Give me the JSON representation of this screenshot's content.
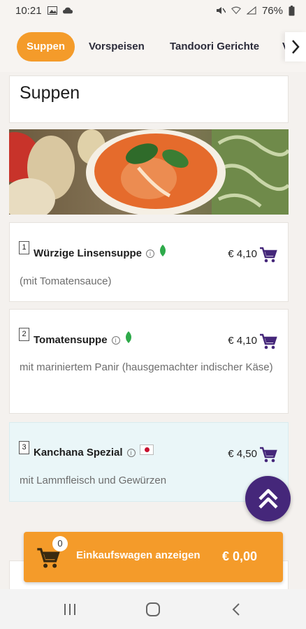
{
  "status_bar": {
    "time": "10:21",
    "battery": "76%"
  },
  "categories": [
    {
      "label": "Suppen",
      "active": true
    },
    {
      "label": "Vorspeisen",
      "active": false
    },
    {
      "label": "Tandoori Gerichte",
      "active": false
    },
    {
      "label": "V",
      "active": false
    }
  ],
  "section": {
    "title": "Suppen"
  },
  "items": [
    {
      "number": "1",
      "name": "Würzige Linsensuppe",
      "price": "€ 4,10",
      "description": "(mit Tomatensauce)",
      "icons": [
        "info-icon",
        "vegetarian-leaf-icon"
      ]
    },
    {
      "number": "2",
      "name": "Tomatensuppe",
      "price": "€ 4,10",
      "description": "mit mariniertem Panir (hausgemachter indischer Käse)",
      "icons": [
        "info-icon",
        "vegetarian-leaf-icon"
      ]
    },
    {
      "number": "3",
      "name": "Kanchana Spezial",
      "price": "€ 4,50",
      "description": "mit Lammfleisch und Gewürzen",
      "icons": [
        "info-icon",
        "meat-flag-icon"
      ]
    }
  ],
  "cart": {
    "count": "0",
    "label": "Einkaufswagen anzeigen",
    "total": "€ 0,00"
  },
  "colors": {
    "accent": "#f49b2a",
    "purple": "#45277a",
    "highlight_row": "#eaf6f8",
    "veg_green": "#2eaa4a"
  }
}
